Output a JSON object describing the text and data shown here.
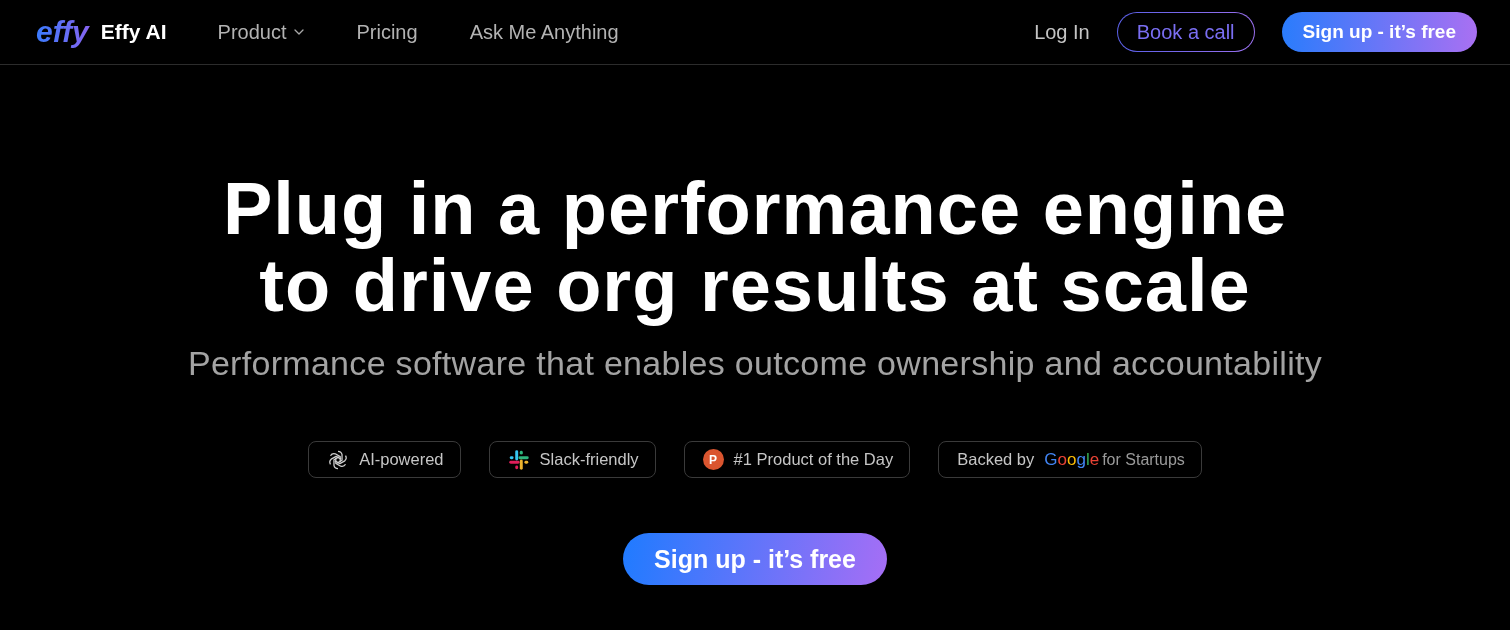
{
  "nav": {
    "logo": {
      "mark": "effy",
      "name": "Effy AI"
    },
    "links": [
      {
        "label": "Product",
        "dropdown": true
      },
      {
        "label": "Pricing",
        "dropdown": false
      },
      {
        "label": "Ask Me Anything",
        "dropdown": false
      }
    ],
    "actions": [
      {
        "kind": "text",
        "label": "Log In"
      },
      {
        "kind": "outline",
        "label": "Book a call"
      },
      {
        "kind": "primary",
        "label": "Sign up - it’s free"
      }
    ]
  },
  "hero": {
    "title_lines": [
      "Plug in a performance engine",
      "to drive org results at scale"
    ],
    "subtitle": "Performance software that enables outcome ownership and accountability",
    "badges": [
      {
        "kind": "ai",
        "label": "AI-powered"
      },
      {
        "kind": "slack",
        "label": "Slack-friendly"
      },
      {
        "kind": "rank",
        "icon_text": "P",
        "label": "#1 Product of the Day"
      },
      {
        "kind": "backer",
        "label": "Backed by",
        "brand": "Google",
        "brand_suffix": "for Startups"
      }
    ],
    "cta": "Sign up - it’s free"
  }
}
